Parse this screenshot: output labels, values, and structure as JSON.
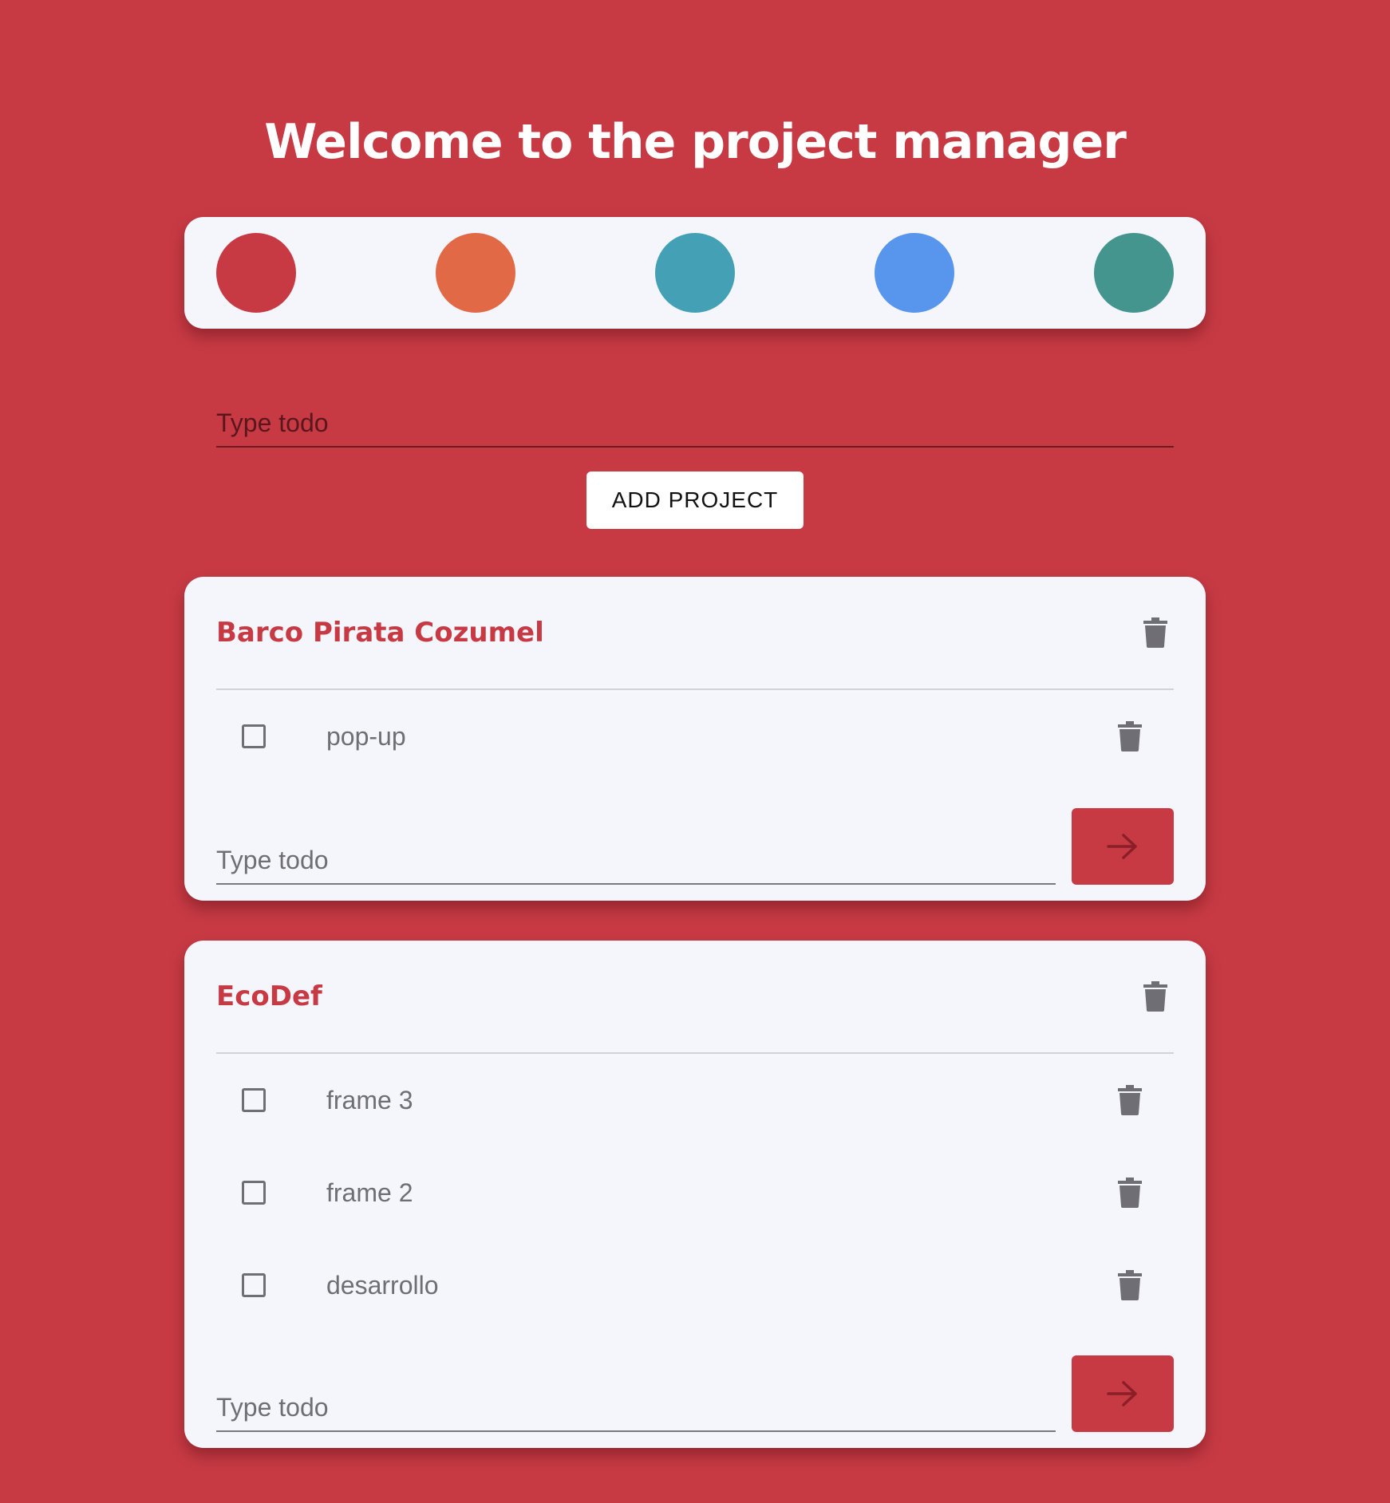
{
  "page": {
    "title": "Welcome to the project manager",
    "background_color": "#c73a44"
  },
  "palette": {
    "colors": [
      "#c73a44",
      "#e26946",
      "#44a1b5",
      "#5896ed",
      "#45958f"
    ]
  },
  "new_project": {
    "placeholder": "Type todo",
    "value": "",
    "add_label": "ADD PROJECT"
  },
  "projects": [
    {
      "name": "Barco Pirata Cozumel",
      "todos": [
        {
          "label": "pop-up",
          "done": false
        }
      ],
      "input_placeholder": "Type todo",
      "submit_icon": "arrow-right-icon",
      "delete_icon": "trash-icon"
    },
    {
      "name": "EcoDef",
      "todos": [
        {
          "label": "frame 3",
          "done": false
        },
        {
          "label": "frame 2",
          "done": false
        },
        {
          "label": "desarrollo",
          "done": false
        }
      ],
      "input_placeholder": "Type todo",
      "submit_icon": "arrow-right-icon",
      "delete_icon": "trash-icon"
    }
  ]
}
